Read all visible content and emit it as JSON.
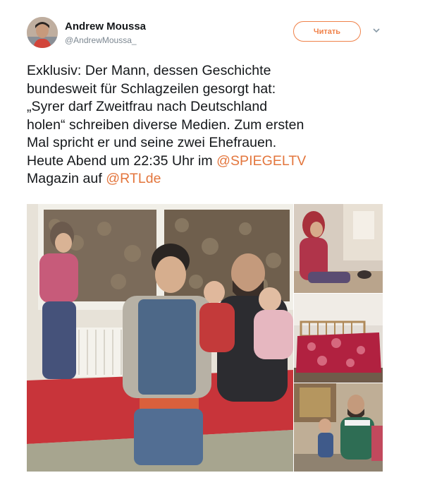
{
  "author": {
    "name": "Andrew Moussa",
    "handle": "@AndrewMoussa_"
  },
  "follow_button": {
    "label": "Читать",
    "color": "#f0824a"
  },
  "more_icon": "chevron-down-icon",
  "tweet": {
    "line1": "Exklusiv: Der Mann, dessen Geschichte",
    "line2": "bundesweit für Schlagzeilen gesorgt hat:",
    "line3": "„Syrer darf Zweitfrau nach Deutschland",
    "line4": "holen“ schreiben diverse Medien. Zum ersten",
    "line5": "Mal spricht er und seine zwei Ehefrauen.",
    "line6_prefix": "Heute Abend um 22:35 Uhr im ",
    "line6_mention": "@SPIEGELTV",
    "line7_prefix": "Magazin auf ",
    "line7_mention": "@RTLde",
    "mention_color": "#e3763d"
  },
  "media": {
    "count": 4
  }
}
